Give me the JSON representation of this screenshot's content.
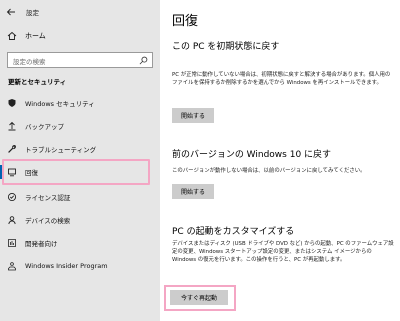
{
  "titlebar": {
    "title": "設定"
  },
  "sidebar": {
    "home_label": "ホーム",
    "search_placeholder": "設定の検索",
    "section_title": "更新とセキュリティ",
    "items": [
      {
        "label": "Windows セキュリティ",
        "icon": "shield-icon"
      },
      {
        "label": "バックアップ",
        "icon": "upload-icon"
      },
      {
        "label": "トラブルシューティング",
        "icon": "wrench-icon"
      },
      {
        "label": "回復",
        "icon": "recovery-icon"
      },
      {
        "label": "ライセンス認証",
        "icon": "check-circle-icon"
      },
      {
        "label": "デバイスの検索",
        "icon": "person-pin-icon"
      },
      {
        "label": "開発者向け",
        "icon": "developer-icon"
      },
      {
        "label": "Windows Insider Program",
        "icon": "insider-icon"
      }
    ],
    "active_index": 3
  },
  "main": {
    "title": "回復",
    "reset": {
      "heading": "この PC を初期状態に戻す",
      "desc": "PC が正常に動作していない場合は、初期状態に戻すと解決する場合があります。個人用のファイルを保持するか削除するかを選んでから Windows を再インストールできます。",
      "button": "開始する"
    },
    "goback": {
      "heading": "前のバージョンの Windows 10 に戻す",
      "desc": "このバージョンが動作しない場合は、以前のバージョンに戻してみてください。",
      "button": "開始する"
    },
    "startup": {
      "heading": "PC の起動をカスタマイズする",
      "desc": "デバイスまたはディスク (USB ドライブや DVD など) からの起動、PC のファームウェア設定の変更、Windows スタートアップ設定の変更、またはシステム イメージからの Windows の復元を行います。この操作を行うと、PC が再起動します。",
      "button": "今すぐ再起動"
    }
  },
  "colors": {
    "sidebar_bg": "#e6e6e6",
    "accent": "#0063b1",
    "highlight": "#f4a6c4",
    "button_bg": "#cccccc"
  }
}
